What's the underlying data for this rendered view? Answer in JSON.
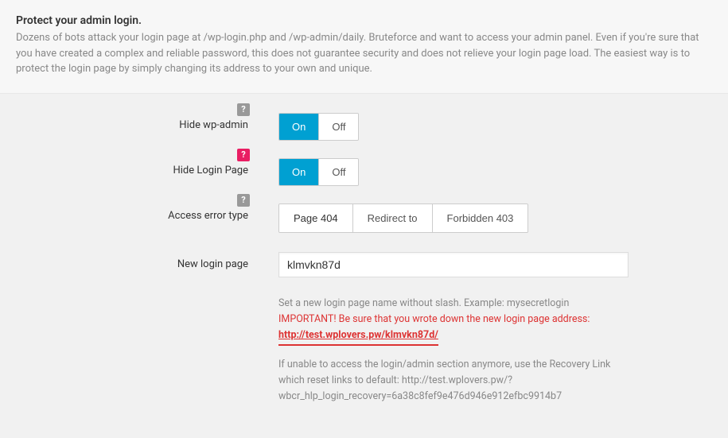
{
  "header": {
    "title": "Protect your admin login.",
    "description": "Dozens of bots attack your login page at /wp-login.php and /wp-admin/daily. Bruteforce and want to access your admin panel. Even if you're sure that you have created a complex and reliable password, this does not guarantee security and does not relieve your login page load. The easiest way is to protect the login page by simply changing its address to your own and unique."
  },
  "fields": {
    "hide_wp_admin": {
      "label": "Hide wp-admin",
      "on": "On",
      "off": "Off",
      "value": "On",
      "help_style": "grey"
    },
    "hide_login_page": {
      "label": "Hide Login Page",
      "on": "On",
      "off": "Off",
      "value": "On",
      "help_style": "pink"
    },
    "access_error_type": {
      "label": "Access error type",
      "options": [
        "Page 404",
        "Redirect to",
        "Forbidden 403"
      ],
      "value": "Page 404",
      "help_style": "grey"
    },
    "new_login_page": {
      "label": "New login page",
      "value": "klmvkn87d",
      "hint1": "Set a new login page name without slash. Example: mysecretlogin",
      "hint_warn": "IMPORTANT! Be sure that you wrote down the new login page address:",
      "hint_url": "http://test.wplovers.pw/klmvkn87d/",
      "hint3": "If unable to access the login/admin section anymore, use the Recovery Link which reset links to default: http://test.wplovers.pw/?wbcr_hlp_login_recovery=6a38c8fef9e476d946e912efbc9914b7"
    }
  },
  "help_symbol": "?"
}
